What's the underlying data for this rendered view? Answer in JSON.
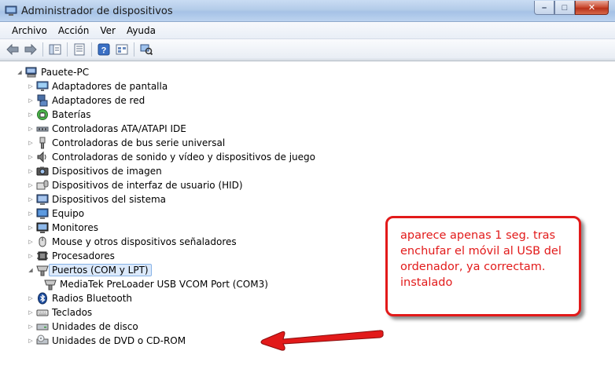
{
  "window": {
    "title": "Administrador de dispositivos",
    "buttons": {
      "minimize": "–",
      "maximize": "□",
      "close": "✕"
    }
  },
  "menu": [
    "Archivo",
    "Acción",
    "Ver",
    "Ayuda"
  ],
  "toolbar": [
    "back-arrow-icon",
    "forward-arrow-icon",
    "show-hide-tree-icon",
    "properties-icon",
    "help-icon",
    "view-icon",
    "scan-hardware-icon"
  ],
  "tree": {
    "root": "Pauete-PC",
    "categories": [
      "Adaptadores de pantalla",
      "Adaptadores de red",
      "Baterías",
      "Controladoras ATA/ATAPI IDE",
      "Controladoras de bus serie universal",
      "Controladoras de sonido y vídeo y dispositivos de juego",
      "Dispositivos de imagen",
      "Dispositivos de interfaz de usuario (HID)",
      "Dispositivos del sistema",
      "Equipo",
      "Monitores",
      "Mouse y otros dispositivos señaladores",
      "Procesadores",
      "Puertos (COM y LPT)",
      "Radios Bluetooth",
      "Teclados",
      "Unidades de disco",
      "Unidades de DVD o CD-ROM"
    ],
    "expanded_child": "MediaTek PreLoader USB VCOM Port (COM3)"
  },
  "annotation": {
    "text": "aparece apenas 1 seg. tras enchufar el móvil al USB del ordenador, ya correctam. instalado",
    "color": "#e21a1a"
  }
}
